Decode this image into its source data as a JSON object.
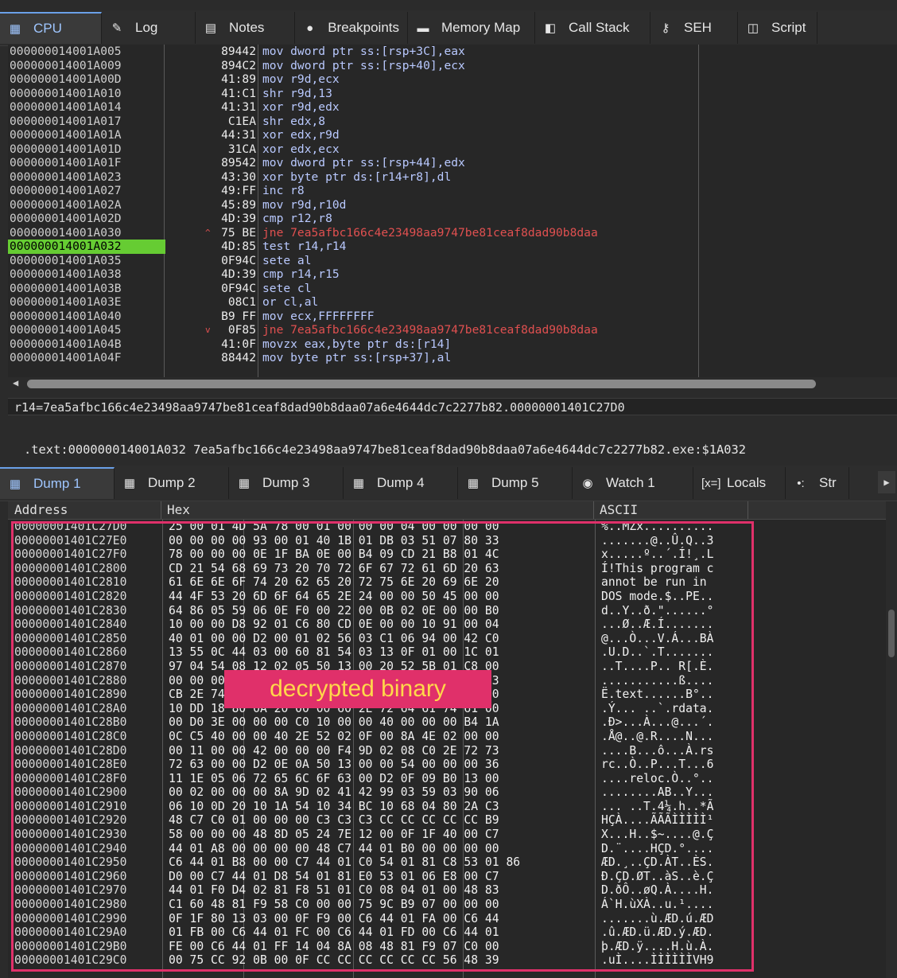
{
  "top_tabs": [
    {
      "label": "CPU",
      "icon": "cpu-icon",
      "glyph": "▦",
      "active": true
    },
    {
      "label": "Log",
      "icon": "log-icon",
      "glyph": "✎",
      "active": false
    },
    {
      "label": "Notes",
      "icon": "notes-icon",
      "glyph": "▤",
      "active": false
    },
    {
      "label": "Breakpoints",
      "icon": "breakpoint-icon",
      "glyph": "●",
      "active": false
    },
    {
      "label": "Memory Map",
      "icon": "memory-map-icon",
      "glyph": "▬",
      "active": false
    },
    {
      "label": "Call Stack",
      "icon": "call-stack-icon",
      "glyph": "◧",
      "active": false
    },
    {
      "label": "SEH",
      "icon": "seh-icon",
      "glyph": "⚷",
      "active": false
    },
    {
      "label": "Script",
      "icon": "script-icon",
      "glyph": "◫",
      "active": false
    }
  ],
  "disasm": [
    {
      "addr": "000000014001A005",
      "mark": "",
      "bytes": "89442",
      "asm": "mov dword ptr ss:[rsp+3C],eax"
    },
    {
      "addr": "000000014001A009",
      "mark": "",
      "bytes": "894C2",
      "asm": "mov dword ptr ss:[rsp+40],ecx"
    },
    {
      "addr": "000000014001A00D",
      "mark": "",
      "bytes": "41:89",
      "asm": "mov r9d,ecx"
    },
    {
      "addr": "000000014001A010",
      "mark": "",
      "bytes": "41:C1",
      "asm": "shr r9d,13"
    },
    {
      "addr": "000000014001A014",
      "mark": "",
      "bytes": "41:31",
      "asm": "xor r9d,edx"
    },
    {
      "addr": "000000014001A017",
      "mark": "",
      "bytes": "C1EA",
      "asm": "shr edx,8"
    },
    {
      "addr": "000000014001A01A",
      "mark": "",
      "bytes": "44:31",
      "asm": "xor edx,r9d"
    },
    {
      "addr": "000000014001A01D",
      "mark": "",
      "bytes": "31CA",
      "asm": "xor edx,ecx"
    },
    {
      "addr": "000000014001A01F",
      "mark": "",
      "bytes": "89542",
      "asm": "mov dword ptr ss:[rsp+44],edx"
    },
    {
      "addr": "000000014001A023",
      "mark": "",
      "bytes": "43:30",
      "asm": "xor byte ptr ds:[r14+r8],dl"
    },
    {
      "addr": "000000014001A027",
      "mark": "",
      "bytes": "49:FF",
      "asm": "inc r8"
    },
    {
      "addr": "000000014001A02A",
      "mark": "",
      "bytes": "45:89",
      "asm": "mov r9d,r10d"
    },
    {
      "addr": "000000014001A02D",
      "mark": "",
      "bytes": "4D:39",
      "asm": "cmp r12,r8"
    },
    {
      "addr": "000000014001A030",
      "mark": "^",
      "bytes": "75 BE",
      "asm": "jne 7ea5afbc166c4e23498aa9747be81ceaf8dad90b8daa",
      "jump": true
    },
    {
      "addr": "000000014001A032",
      "mark": "",
      "bytes": "4D:85",
      "asm": "test r14,r14",
      "current": true
    },
    {
      "addr": "000000014001A035",
      "mark": "",
      "bytes": "0F94C",
      "asm": "sete al"
    },
    {
      "addr": "000000014001A038",
      "mark": "",
      "bytes": "4D:39",
      "asm": "cmp r14,r15"
    },
    {
      "addr": "000000014001A03B",
      "mark": "",
      "bytes": "0F94C",
      "asm": "sete cl"
    },
    {
      "addr": "000000014001A03E",
      "mark": "",
      "bytes": "08C1",
      "asm": "or cl,al"
    },
    {
      "addr": "000000014001A040",
      "mark": "",
      "bytes": "B9 FF",
      "asm": "mov ecx,FFFFFFFF"
    },
    {
      "addr": "000000014001A045",
      "mark": "v",
      "bytes": "0F85",
      "asm": "jne 7ea5afbc166c4e23498aa9747be81ceaf8dad90b8daa",
      "jump": true
    },
    {
      "addr": "000000014001A04B",
      "mark": "",
      "bytes": "41:0F",
      "asm": "movzx eax,byte ptr ds:[r14]"
    },
    {
      "addr": "000000014001A04F",
      "mark": "",
      "bytes": "88442",
      "asm": "mov byte ptr ss:[rsp+37],al"
    }
  ],
  "info_line1": "r14=7ea5afbc166c4e23498aa9747be81ceaf8dad90b8daa07a6e4644dc7c2277b82.00000001401C27D0",
  "info_line2": ".text:000000014001A032 7ea5afbc166c4e23498aa9747be81ceaf8dad90b8daa07a6e4644dc7c2277b82.exe:$1A032",
  "dump_tabs": [
    {
      "label": "Dump 1",
      "icon": "dump-icon",
      "glyph": "▦",
      "active": true
    },
    {
      "label": "Dump 2",
      "icon": "dump-icon",
      "glyph": "▦",
      "active": false
    },
    {
      "label": "Dump 3",
      "icon": "dump-icon",
      "glyph": "▦",
      "active": false
    },
    {
      "label": "Dump 4",
      "icon": "dump-icon",
      "glyph": "▦",
      "active": false
    },
    {
      "label": "Dump 5",
      "icon": "dump-icon",
      "glyph": "▦",
      "active": false
    },
    {
      "label": "Watch 1",
      "icon": "watch-icon",
      "glyph": "◉",
      "active": false
    },
    {
      "label": "Locals",
      "icon": "locals-icon",
      "glyph": "[x=]",
      "active": false
    },
    {
      "label": "Str",
      "icon": "struct-icon",
      "glyph": "•:",
      "active": false
    }
  ],
  "dump_headers": {
    "address": "Address",
    "hex": "Hex",
    "ascii": "ASCII"
  },
  "dump_rows": [
    {
      "addr": "00000001401C27D0",
      "hex": "25 00 01 4D 5A 78 00 01 00 00 00 04 00 00 00 00",
      "ascii": "%..MZx.........."
    },
    {
      "addr": "00000001401C27E0",
      "hex": "00 00 00 00 93 00 01 40 1B 01 DB 03 51 07 80 33",
      "ascii": ".......@..Û.Q..3"
    },
    {
      "addr": "00000001401C27F0",
      "hex": "78 00 00 00 0E 1F BA 0E 00 B4 09 CD 21 B8 01 4C",
      "ascii": "x.....º..´.Í!¸.L"
    },
    {
      "addr": "00000001401C2800",
      "hex": "CD 21 54 68 69 73 20 70 72 6F 67 72 61 6D 20 63",
      "ascii": "Í!This program c"
    },
    {
      "addr": "00000001401C2810",
      "hex": "61 6E 6E 6F 74 20 62 65 20 72 75 6E 20 69 6E 20",
      "ascii": "annot be run in "
    },
    {
      "addr": "00000001401C2820",
      "hex": "44 4F 53 20 6D 6F 64 65 2E 24 00 00 50 45 00 00",
      "ascii": "DOS mode.$..PE.."
    },
    {
      "addr": "00000001401C2830",
      "hex": "64 86 05 59 06 0E F0 00 22 00 0B 02 0E 00 00 B0",
      "ascii": "d..Y..ð.\"......°"
    },
    {
      "addr": "00000001401C2840",
      "hex": "10 00 00 D8 92 01 C6 80 CD 0E 00 00 10 91 00 04",
      "ascii": "...Ø..Æ.Í......."
    },
    {
      "addr": "00000001401C2850",
      "hex": "40 01 00 00 D2 00 01 02 56 03 C1 06 94 00 42 C0",
      "ascii": "@...Ò...V.Á...BÀ"
    },
    {
      "addr": "00000001401C2860",
      "hex": "13 55 0C 44 03 00 60 81 54 03 13 0F 01 00 1C 01",
      "ascii": ".U.D..`.T......."
    },
    {
      "addr": "00000001401C2870",
      "hex": "97 04 54 08 12 02 05 50 13 00 20 52 5B 01 C8 00",
      "ascii": "..T....P.. R[.È."
    },
    {
      "addr": "00000001401C2880",
      "hex": "00 00 00 00 00 00 00 00 00 00 00 5F 12 13 13 13",
      "ascii": "...........ß...."
    },
    {
      "addr": "00000001401C2890",
      "hex": "CB 2E 74 65 78 74 00 00 00 00 00 00 0B 42 B0 00",
      "ascii": "Ë.text......B°.."
    },
    {
      "addr": "00000001401C28A0",
      "hex": "10 DD 18 80 0A 20 00 00 60 2E 72 64 61 74 61 00",
      "ascii": ".Ý... ..`.rdata."
    },
    {
      "addr": "00000001401C28B0",
      "hex": "00 D0 3E 00 00 00 C0 10 00 00 40 00 00 00 B4 1A",
      "ascii": ".Ð>...À...@...´."
    },
    {
      "addr": "00000001401C28C0",
      "hex": "0C C5 40 00 00 40 2E 52 02 0F 00 8A 4E 02 00 00",
      "ascii": ".Å@..@.R....N..."
    },
    {
      "addr": "00000001401C28D0",
      "hex": "00 11 00 00 42 00 00 00 F4 9D 02 08 C0 2E 72 73",
      "ascii": "....B...ô...À.rs"
    },
    {
      "addr": "00000001401C28E0",
      "hex": "72 63 00 00 D2 0E 0A 50 13 00 00 54 00 00 00 36",
      "ascii": "rc..Ò..P...T...6"
    },
    {
      "addr": "00000001401C28F0",
      "hex": "11 1E 05 06 72 65 6C 6F 63 00 D2 0F 09 B0 13 00",
      "ascii": "....reloc.Ò..°.."
    },
    {
      "addr": "00000001401C2900",
      "hex": "00 02 00 00 00 8A 9D 02 41 42 99 03 59 03 90 06",
      "ascii": "........AB..Y..."
    },
    {
      "addr": "00000001401C2910",
      "hex": "06 10 0D 20 10 1A 54 10 34 BC 10 68 04 80 2A C3",
      "ascii": "... ..T.4¼.h..*Ã"
    },
    {
      "addr": "00000001401C2920",
      "hex": "48 C7 C0 01 00 00 00 C3 C3 C3 CC CC CC CC CC B9",
      "ascii": "HÇÀ....ÃÃÃÌÌÌÌÌ¹"
    },
    {
      "addr": "00000001401C2930",
      "hex": "58 00 00 00 48 8D 05 24 7E 12 00 0F 1F 40 00 C7",
      "ascii": "X...H..$~....@.Ç"
    },
    {
      "addr": "00000001401C2940",
      "hex": "44 01 A8 00 00 00 00 48 C7 44 01 B0 00 00 00 00",
      "ascii": "D.¨....HÇD.°...."
    },
    {
      "addr": "00000001401C2950",
      "hex": "C6 44 01 B8 00 00 C7 44 01 C0 54 01 81 C8 53 01 86",
      "ascii": "ÆD.¸..ÇD.ÀT..ÈS."
    },
    {
      "addr": "00000001401C2960",
      "hex": "D0 00 C7 44 01 D8 54 01 81 E0 53 01 06 E8 00 C7",
      "ascii": "Ð.ÇD.ØT..àS..è.Ç"
    },
    {
      "addr": "00000001401C2970",
      "hex": "44 01 F0 D4 02 81 F8 51 01 C0 08 04 01 00 48 83",
      "ascii": "D.ðÔ..øQ.À....H."
    },
    {
      "addr": "00000001401C2980",
      "hex": "C1 60 48 81 F9 58 C0 00 00 75 9C B9 07 00 00 00",
      "ascii": "Á`H.ùXÀ..u.¹...."
    },
    {
      "addr": "00000001401C2990",
      "hex": "0F 1F 80 13 03 00 0F F9 00 C6 44 01 FA 00 C6 44",
      "ascii": ".......ù.ÆD.ú.ÆD"
    },
    {
      "addr": "00000001401C29A0",
      "hex": "01 FB 00 C6 44 01 FC 00 C6 44 01 FD 00 C6 44 01",
      "ascii": ".û.ÆD.ü.ÆD.ý.ÆD."
    },
    {
      "addr": "00000001401C29B0",
      "hex": "FE 00 C6 44 01 FF 14 04 8A 08 48 81 F9 07 C0 00",
      "ascii": "þ.ÆD.ÿ....H.ù.À."
    },
    {
      "addr": "00000001401C29C0",
      "hex": "00 75 CC 92 0B 00 0F CC CC CC CC CC CC 56 48 39",
      "ascii": ".uÌ....ÌÌÌÌÌÌVH9"
    }
  ],
  "annotation_label": "decrypted binary",
  "colors": {
    "current_addr": "#66cc33",
    "jump": "#e05050",
    "mnemonic": "#8fb0ff",
    "register": "#b9c9ff",
    "highlight": "#e0306a",
    "annotation_text": "#ffd84a"
  }
}
